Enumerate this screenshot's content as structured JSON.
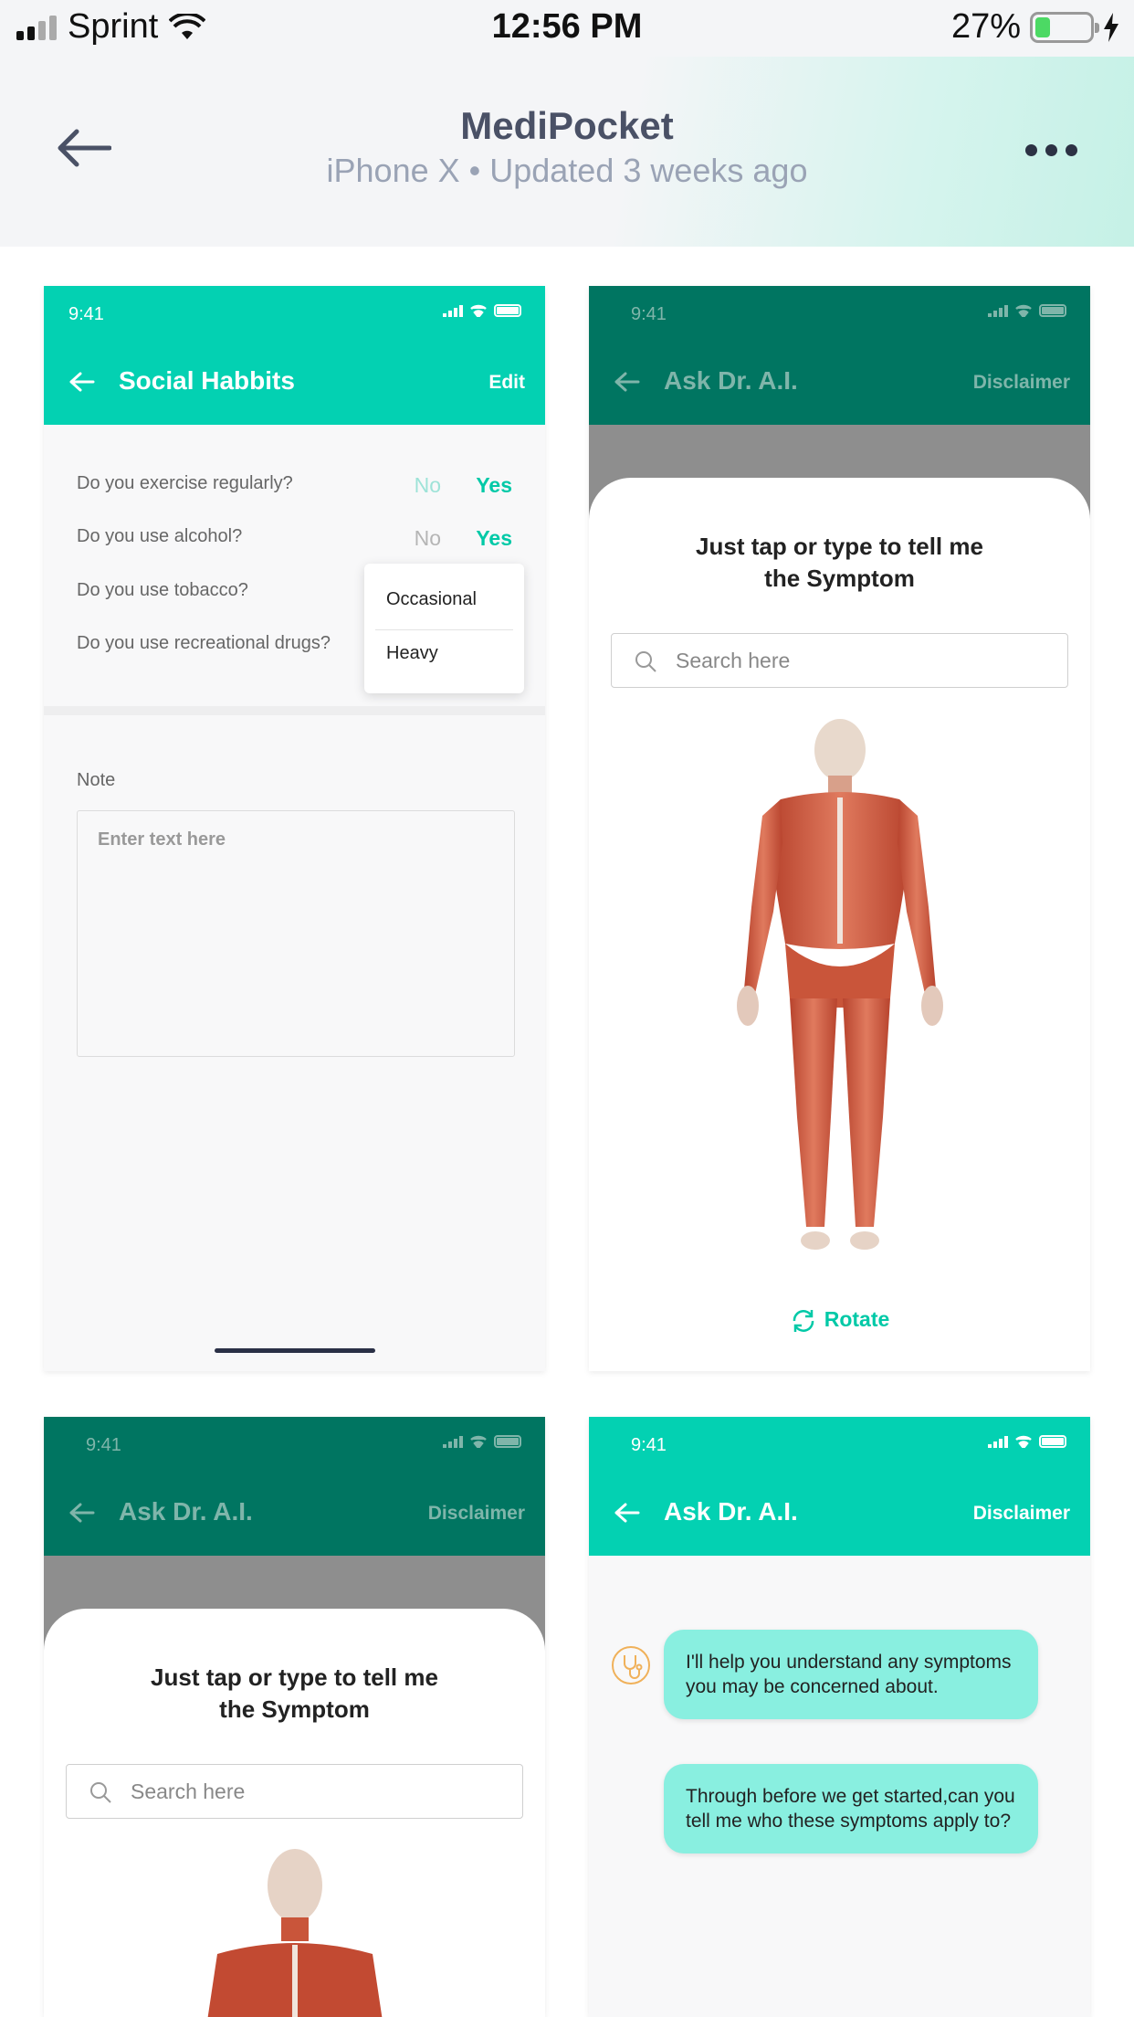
{
  "status_bar": {
    "carrier": "Sprint",
    "time": "12:56 PM",
    "battery": "27%",
    "battery_level": 0.27
  },
  "app_header": {
    "title": "MediPocket",
    "subtitle": "iPhone X • Updated 3 weeks ago"
  },
  "screens": [
    {
      "time": "9:41",
      "title": "Social Habbits",
      "action": "Edit",
      "questions": [
        {
          "label": "Do you exercise regularly?",
          "no": "No",
          "yes": "Yes"
        },
        {
          "label": "Do you use alcohol?",
          "no": "No",
          "yes": "Yes"
        },
        {
          "label": "Do you use tobacco?"
        },
        {
          "label": "Do you use recreational drugs?"
        }
      ],
      "dropdown_options": [
        "Occasional",
        "Heavy"
      ],
      "note_label": "Note",
      "note_placeholder": "Enter text here"
    },
    {
      "time": "9:41",
      "title": "Ask Dr. A.I.",
      "action": "Disclaimer",
      "heading_line1": "Just tap or type to tell me",
      "heading_line2": "the Symptom",
      "search_placeholder": "Search here",
      "rotate_label": "Rotate"
    },
    {
      "time": "9:41",
      "title": "Ask Dr. A.I.",
      "action": "Disclaimer",
      "heading_line1": "Just tap or type to tell me",
      "heading_line2": "the Symptom",
      "search_placeholder": "Search here"
    },
    {
      "time": "9:41",
      "title": "Ask Dr. A.I.",
      "action": "Disclaimer",
      "messages": [
        "I'll help you understand any symptoms you may be concerned about.",
        "Through before we get started,can you tell me who these symptoms apply to?"
      ]
    }
  ],
  "colors": {
    "accent": "#03d1b2",
    "accent_dark": "#007561",
    "chat_bubble": "#89efe0",
    "header_text": "#4a5166"
  },
  "icons": [
    "back-arrow-icon",
    "more-icon",
    "search-icon",
    "rotate-icon",
    "stethoscope-icon",
    "wifi-icon",
    "battery-icon",
    "signal-icon"
  ]
}
